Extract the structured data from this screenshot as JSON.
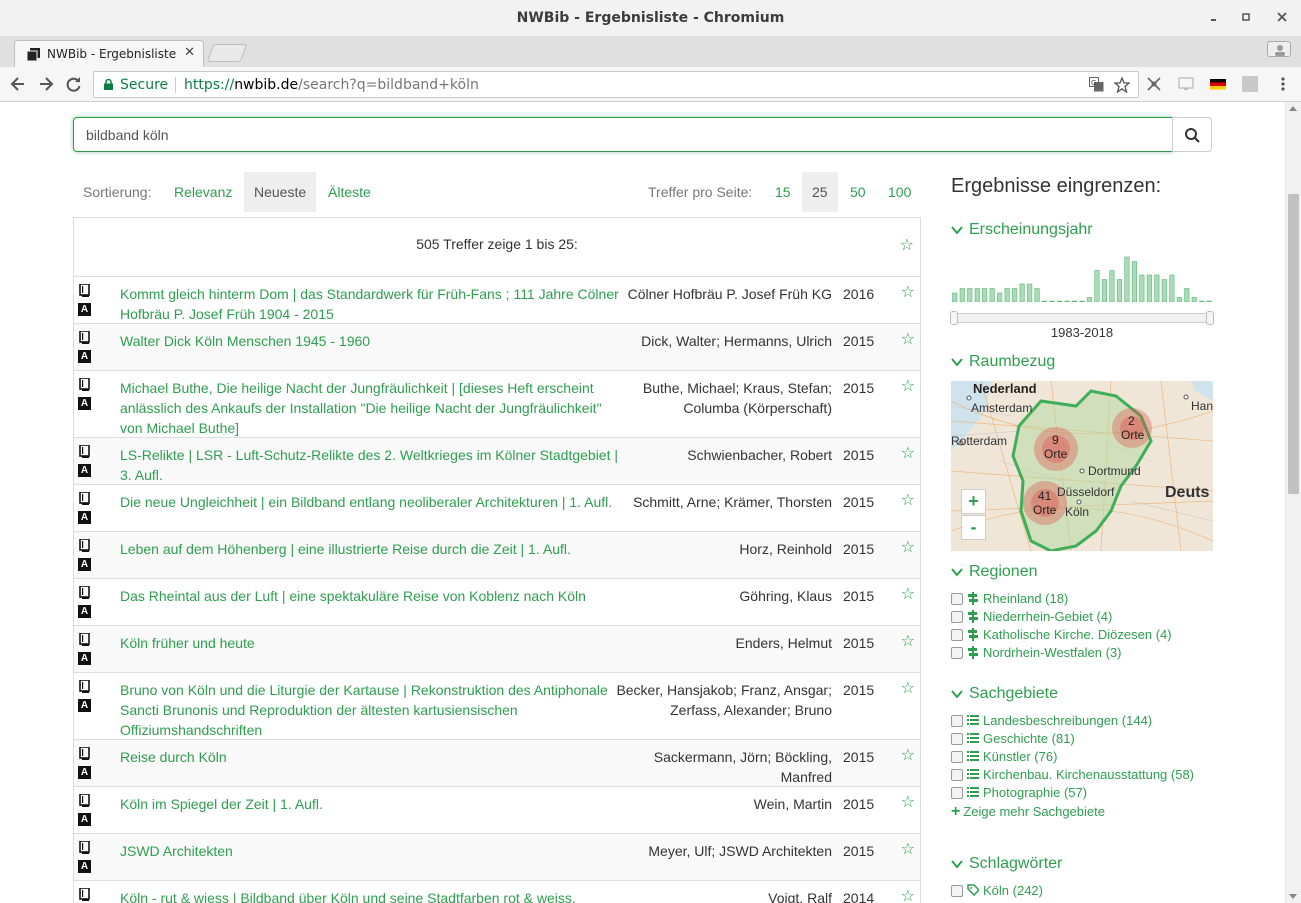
{
  "window": {
    "title": "NWBib - Ergebnisliste - Chromium",
    "minimize": "▪",
    "maximize": "▪",
    "close": "✕"
  },
  "tab": {
    "title": "NWBib - Ergebnisliste",
    "close": "✕"
  },
  "omnibox": {
    "secure_label": "Secure",
    "url_protocol": "https://",
    "url_host": "nwbib.de",
    "url_path": "/search?q=bildband+köln"
  },
  "search": {
    "query": "bildband köln"
  },
  "sort": {
    "label": "Sortierung:",
    "options": [
      "Relevanz",
      "Neueste",
      "Älteste"
    ],
    "active": "Neueste"
  },
  "per_page": {
    "label": "Treffer pro Seite:",
    "options": [
      "15",
      "25",
      "50",
      "100"
    ],
    "active": "25"
  },
  "results": {
    "summary": "505 Treffer zeige 1 bis 25:",
    "items": [
      {
        "title": "Kommt gleich hinterm Dom | das Standardwerk für Früh-Fans ; 111 Jahre Cölner Hofbräu P. Josef Früh 1904 - 2015",
        "author": "Cölner Hofbräu P. Josef Früh KG",
        "year": "2016"
      },
      {
        "title": "Walter Dick Köln Menschen 1945 - 1960",
        "author": "Dick, Walter; Hermanns, Ulrich",
        "year": "2015"
      },
      {
        "title": "Michael Buthe, Die heilige Nacht der Jungfräulichkeit | [dieses Heft erscheint anlässlich des Ankaufs der Installation \"Die heilige Nacht der Jungfräulichkeit\" von Michael Buthe]",
        "author": "Buthe, Michael; Kraus, Stefan; Columba (Körperschaft)",
        "year": "2015"
      },
      {
        "title": "LS-Relikte | LSR - Luft-Schutz-Relikte des 2. Weltkrieges im Kölner Stadtgebiet | 3. Aufl.",
        "author": "Schwienbacher, Robert",
        "year": "2015"
      },
      {
        "title": "Die neue Ungleichheit | ein Bildband entlang neoliberaler Architekturen | 1. Aufl.",
        "author": "Schmitt, Arne; Krämer, Thorsten",
        "year": "2015"
      },
      {
        "title": "Leben auf dem Höhenberg | eine illustrierte Reise durch die Zeit | 1. Aufl.",
        "author": "Horz, Reinhold",
        "year": "2015"
      },
      {
        "title": "Das Rheintal aus der Luft | eine spektakuläre Reise von Koblenz nach Köln",
        "author": "Göhring, Klaus",
        "year": "2015"
      },
      {
        "title": "Köln früher und heute",
        "author": "Enders, Helmut",
        "year": "2015"
      },
      {
        "title": "Bruno von Köln und die Liturgie der Kartause | Rekonstruktion des Antiphonale Sancti Brunonis und Reproduktion der ältesten kartusiensischen Offiziumshandschriften",
        "author": "Becker, Hansjakob; Franz, Ansgar; Zerfass, Alexander; Bruno",
        "year": "2015"
      },
      {
        "title": "Reise durch Köln",
        "author": "Sackermann, Jörn; Böckling, Manfred",
        "year": "2015"
      },
      {
        "title": "Köln im Spiegel der Zeit | 1. Aufl.",
        "author": "Wein, Martin",
        "year": "2015"
      },
      {
        "title": "JSWD Architekten",
        "author": "Meyer, Ulf; JSWD Architekten",
        "year": "2015"
      },
      {
        "title": "Köln - rut & wiess | Bildband über Köln und seine Stadtfarben rot & weiss.",
        "author": "Voigt, Ralf",
        "year": "2014"
      }
    ]
  },
  "sidebar": {
    "title": "Ergebnisse eingrenzen:",
    "year_facet": {
      "label": "Erscheinungsjahr",
      "range": "1983-2018",
      "histogram": [
        2,
        3,
        3,
        3,
        3,
        3,
        2,
        3,
        3,
        4,
        4,
        3,
        0,
        0,
        0,
        0,
        0,
        0,
        1,
        7,
        5,
        7,
        5,
        10,
        9,
        6,
        6,
        6,
        5,
        6,
        1,
        3,
        1,
        0,
        0
      ]
    },
    "place_facet": {
      "label": "Raumbezug",
      "zoom_in": "+",
      "zoom_out": "-",
      "map_labels": [
        "Nederland",
        "Amsterdam",
        "Rotterdam",
        "Dortmund",
        "Düsseldorf",
        "Köln",
        "Deuts",
        "Han"
      ],
      "clusters": [
        {
          "count": "9",
          "label": "Orte"
        },
        {
          "count": "2",
          "label": "Orte"
        },
        {
          "count": "41",
          "label": "Orte"
        }
      ]
    },
    "regions": {
      "label": "Regionen",
      "items": [
        "Rheinland (18)",
        "Niederrhein-Gebiet (4)",
        "Katholische Kirche. Diözesen (4)",
        "Nordrhein-Westfalen (3)"
      ]
    },
    "subjects": {
      "label": "Sachgebiete",
      "items": [
        "Landesbeschreibungen (144)",
        "Geschichte (81)",
        "Künstler (76)",
        "Kirchenbau. Kirchenausstattung (58)",
        "Photographie (57)"
      ],
      "more": "Zeige mehr Sachgebiete"
    },
    "keywords": {
      "label": "Schlagwörter",
      "items": [
        "Köln (242)"
      ]
    }
  },
  "colors": {
    "accent": "#2e9e4f",
    "text": "#333333"
  }
}
